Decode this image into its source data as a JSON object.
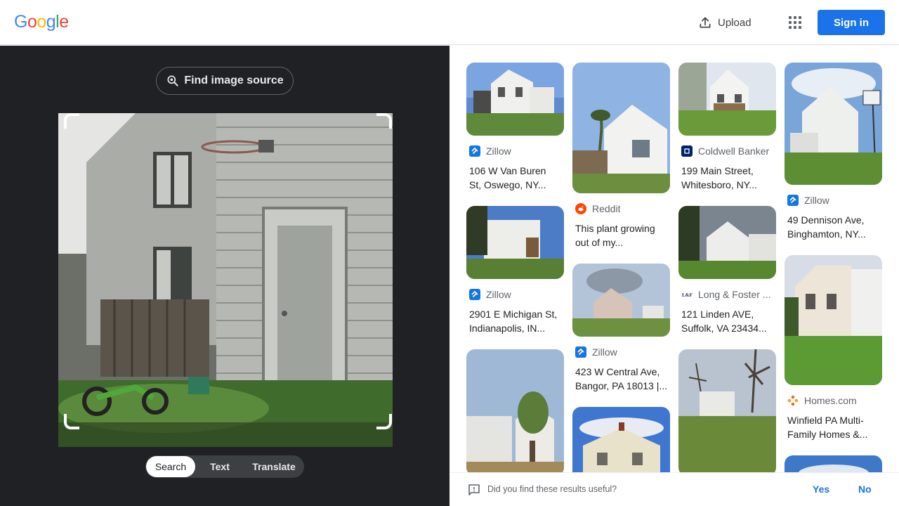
{
  "header": {
    "logo_letters": [
      "G",
      "o",
      "o",
      "g",
      "l",
      "e"
    ],
    "logo_colors": [
      "#4285f4",
      "#ea4335",
      "#fbbc05",
      "#4285f4",
      "#34a853",
      "#ea4335"
    ],
    "upload_label": "Upload",
    "signin_label": "Sign in",
    "apps_icon": "apps-grid-icon"
  },
  "left": {
    "find_source_label": "Find image source",
    "modes": [
      "Search",
      "Text",
      "Translate"
    ],
    "active_mode": "Search"
  },
  "results": {
    "columns": [
      [
        {
          "source": "Zillow",
          "title": [
            "106 W Van Buren",
            "St, Oswego, NY..."
          ],
          "icon": "zillow-icon"
        },
        {
          "source": "Zillow",
          "title": [
            "2901 E Michigan St,",
            "Indianapolis, IN..."
          ],
          "icon": "zillow-icon"
        },
        {
          "source": "",
          "title": [],
          "icon": ""
        }
      ],
      [
        {
          "source": "",
          "title": [],
          "icon": ""
        },
        {
          "source": "Reddit",
          "title": [
            "This plant growing",
            "out of my..."
          ],
          "icon": "reddit-icon"
        },
        {
          "source": "Zillow",
          "title": [
            "423 W Central Ave,",
            "Bangor, PA 18013 |..."
          ],
          "icon": "zillow-icon"
        },
        {
          "source": "",
          "title": [],
          "icon": ""
        }
      ],
      [
        {
          "source": "Coldwell Banker",
          "title": [
            "199 Main Street,",
            "Whitesboro, NY..."
          ],
          "icon": "coldwell-banker-icon"
        },
        {
          "source": "Long & Foster ...",
          "title": [
            "121 Linden AVE,",
            "Suffolk, VA 23434..."
          ],
          "icon": "long-foster-icon"
        },
        {
          "source": "",
          "title": [],
          "icon": ""
        }
      ],
      [
        {
          "source": "Zillow",
          "title": [
            "49 Dennison Ave,",
            "Binghamton, NY..."
          ],
          "icon": "zillow-icon"
        },
        {
          "source": "Homes.com",
          "title": [
            "Winfield PA Multi-",
            "Family Homes &..."
          ],
          "icon": "homes-com-icon"
        },
        {
          "source": "",
          "title": [],
          "icon": ""
        }
      ]
    ]
  },
  "feedback": {
    "question": "Did you find these results useful?",
    "yes": "Yes",
    "no": "No"
  },
  "colors": {
    "accent": "#1a73e8",
    "dark_pane": "#202124",
    "zillow": "#1277e1",
    "reddit": "#ff4500",
    "coldwell": "#012169",
    "homes": "#f26e21"
  }
}
